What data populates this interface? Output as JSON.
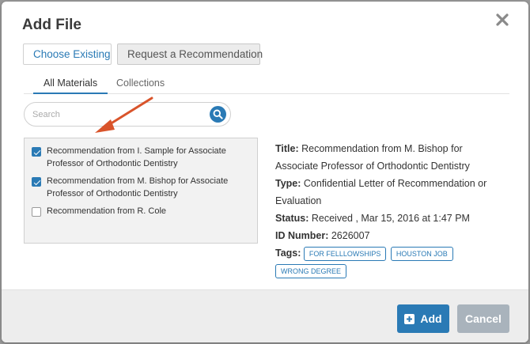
{
  "dialog": {
    "title": "Add File"
  },
  "tabs": {
    "choose_existing": "Choose Existing",
    "request_recommendation": "Request a Recommendation"
  },
  "subtabs": {
    "all_materials": "All Materials",
    "collections": "Collections"
  },
  "search": {
    "placeholder": "Search",
    "value": ""
  },
  "materials": [
    {
      "label": "Recommendation from I. Sample for Associate Professor of Orthodontic Dentistry",
      "checked": true
    },
    {
      "label": "Recommendation from M. Bishop for Associate Professor of Orthodontic Dentistry",
      "checked": true
    },
    {
      "label": "Recommendation from R. Cole",
      "checked": false
    }
  ],
  "details": {
    "title_label": "Title:",
    "title_value": "Recommendation from M. Bishop for Associate Professor of Orthodontic Dentistry",
    "type_label": "Type:",
    "type_value": "Confidential Letter of Recommendation or Evaluation",
    "status_label": "Status:",
    "status_value": "Received , Mar 15, 2016 at 1:47 PM",
    "id_label": "ID Number:",
    "id_value": "2626007",
    "tags_label": "Tags:",
    "tags": [
      "FOR FELLLOWSHIPS",
      "HOUSTON JOB",
      "WRONG DEGREE"
    ]
  },
  "footer": {
    "add_label": "Add",
    "cancel_label": "Cancel"
  },
  "colors": {
    "accent": "#2a7ab5",
    "annotation_arrow": "#d9542b",
    "cancel": "#a9b3bc"
  }
}
